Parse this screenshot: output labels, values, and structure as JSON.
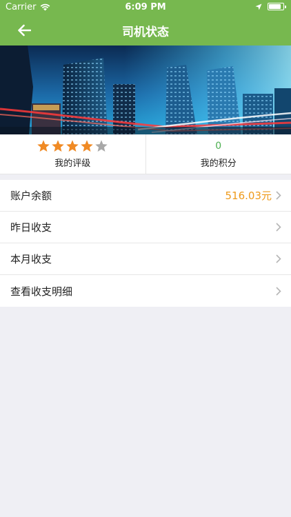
{
  "status_bar": {
    "carrier": "Carrier",
    "time": "6:09 PM",
    "battery_level": 0.9
  },
  "nav": {
    "title": "司机状态",
    "back_icon": "back-arrow-icon"
  },
  "banner": {
    "description": ""
  },
  "stats": {
    "rating": {
      "stars_filled": 4,
      "stars_total": 5,
      "label": "我的评级"
    },
    "points": {
      "value": "0",
      "label": "我的积分"
    }
  },
  "menu": {
    "items": [
      {
        "label": "账户余额",
        "value": "516.03元"
      },
      {
        "label": "昨日收支",
        "value": ""
      },
      {
        "label": "本月收支",
        "value": ""
      },
      {
        "label": "查看收支明细",
        "value": ""
      }
    ]
  },
  "colors": {
    "header": "#77b84f",
    "star_on": "#f08a24",
    "star_off": "#a8a8a8",
    "points": "#4caf50",
    "balance": "#ee9a1a",
    "background": "#efeff4"
  }
}
